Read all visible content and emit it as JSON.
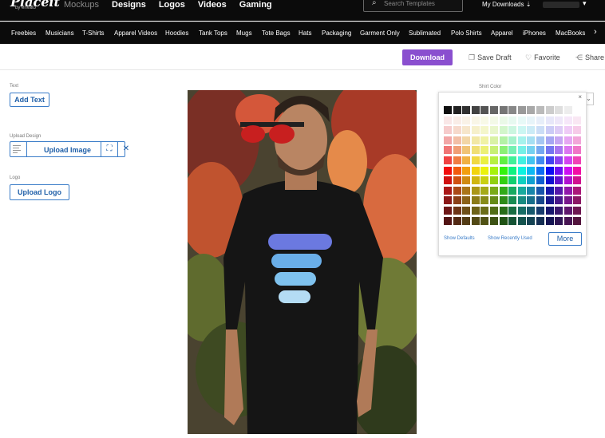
{
  "brand": {
    "logo_text": "Placeit",
    "logo_sub": "by envato"
  },
  "main_nav": [
    {
      "label": "Mockups",
      "active": false
    },
    {
      "label": "Designs",
      "active": true
    },
    {
      "label": "Logos",
      "active": true
    },
    {
      "label": "Videos",
      "active": true
    },
    {
      "label": "Gaming",
      "active": true
    }
  ],
  "search": {
    "placeholder": "Search Templates",
    "icon": "search-icon"
  },
  "account": {
    "my_downloads": "My Downloads ⇣",
    "caret": "▾"
  },
  "categories": [
    "Freebies",
    "Musicians",
    "T-Shirts",
    "Apparel Videos",
    "Hoodies",
    "Tank Tops",
    "Mugs",
    "Tote Bags",
    "Hats",
    "Packaging",
    "Garment Only",
    "Sublimated",
    "Polo Shirts",
    "Apparel",
    "iPhones",
    "MacBooks"
  ],
  "category_next": "›",
  "actions": {
    "download": "Download",
    "save_draft": "Save Draft",
    "favorite": "Favorite",
    "share": "Share"
  },
  "left_panel": {
    "text_label": "Text",
    "add_text": "Add Text",
    "upload_design_label": "Upload Design",
    "upload_image": "Upload Image",
    "crop_icon_glyph": "⛶",
    "remove_glyph": "✕",
    "logo_label": "Logo",
    "upload_logo": "Upload Logo"
  },
  "shirt_color": {
    "label": "Shirt Color",
    "close": "×",
    "show_defaults": "Show Defaults",
    "show_recently_used": "Show Recently Used",
    "more": "More",
    "selected": "#111111"
  },
  "colors": {
    "accent": "#8a4fcf",
    "link": "#3a7cc8",
    "nav_bg": "#0b0b0b"
  }
}
